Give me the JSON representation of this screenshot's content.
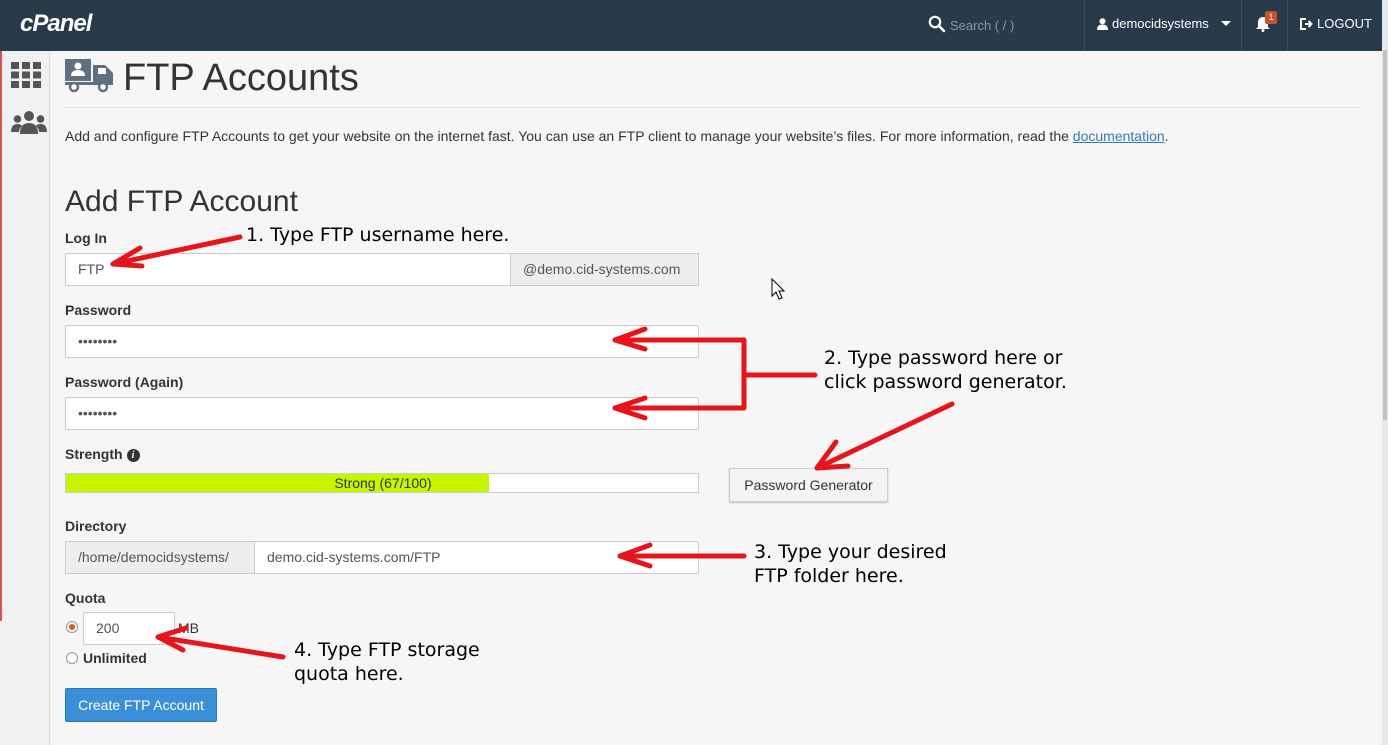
{
  "header": {
    "logo": "cPanel",
    "search_placeholder": "Search ( / )",
    "username": "democidsystems",
    "notification_count": "1",
    "logout_label": "LOGOUT"
  },
  "page": {
    "title": "FTP Accounts",
    "description": "Add and configure FTP Accounts to get your website on the internet fast. You can use an FTP client to manage your website’s files. For more information, read the ",
    "doc_link": "documentation",
    "desc_end": "."
  },
  "form": {
    "section_title": "Add FTP Account",
    "login_label": "Log In",
    "login_value": "FTP",
    "domain_addon": "@demo.cid-systems.com",
    "password_label": "Password",
    "password_value": "••••••••",
    "password_again_label": "Password (Again)",
    "password_again_value": "••••••••",
    "strength_label": "Strength",
    "strength_text": "Strong (67/100)",
    "strength_value": 67,
    "password_generator_label": "Password Generator",
    "directory_label": "Directory",
    "directory_prefix": "/home/democidsystems/",
    "directory_value": "demo.cid-systems.com/FTP",
    "quota_label": "Quota",
    "quota_value": "200",
    "quota_unit": "MB",
    "unlimited_label": "Unlimited",
    "submit_label": "Create FTP Account"
  },
  "annotations": {
    "step1": "1. Type FTP username here.",
    "step2_line1": "2. Type password here or",
    "step2_line2": "click password generator.",
    "step3_line1": "3. Type your desired",
    "step3_line2": "FTP folder here.",
    "step4_line1": "4. Type FTP storage",
    "step4_line2": "quota here.",
    "arrow_color": "#e8141b"
  }
}
